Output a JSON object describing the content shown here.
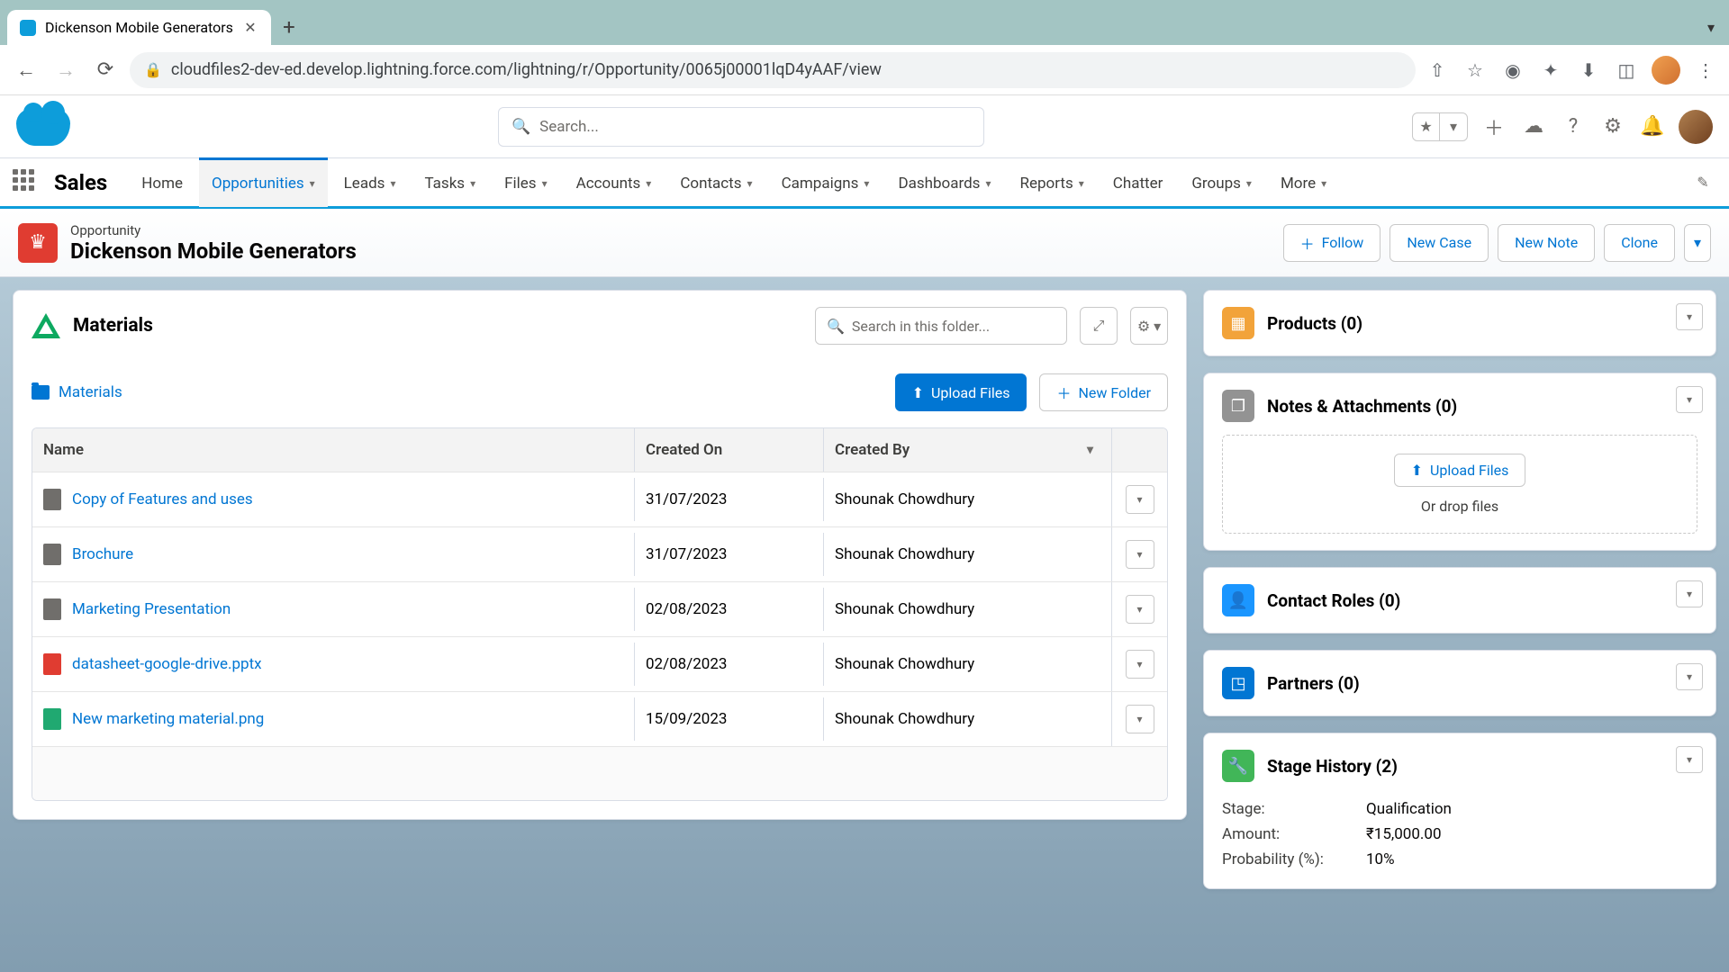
{
  "browser": {
    "tab_title": "Dickenson Mobile Generators",
    "url": "cloudfiles2-dev-ed.develop.lightning.force.com/lightning/r/Opportunity/0065j00001lqD4yAAF/view"
  },
  "sf": {
    "search_placeholder": "Search...",
    "app_name": "Sales",
    "nav": [
      "Home",
      "Opportunities",
      "Leads",
      "Tasks",
      "Files",
      "Accounts",
      "Contacts",
      "Campaigns",
      "Dashboards",
      "Reports",
      "Chatter",
      "Groups",
      "More"
    ]
  },
  "record": {
    "type": "Opportunity",
    "title": "Dickenson Mobile Generators",
    "actions": {
      "follow": "Follow",
      "new_case": "New Case",
      "new_note": "New Note",
      "clone": "Clone"
    }
  },
  "materials": {
    "title": "Materials",
    "search_placeholder": "Search in this folder...",
    "breadcrumb": "Materials",
    "upload_btn": "Upload Files",
    "new_folder_btn": "New Folder",
    "cols": {
      "name": "Name",
      "created_on": "Created On",
      "created_by": "Created By"
    },
    "rows": [
      {
        "name": "Copy of Features and uses",
        "date": "31/07/2023",
        "by": "Shounak Chowdhury",
        "icon": "generic"
      },
      {
        "name": "Brochure",
        "date": "31/07/2023",
        "by": "Shounak Chowdhury",
        "icon": "generic"
      },
      {
        "name": "Marketing Presentation",
        "date": "02/08/2023",
        "by": "Shounak Chowdhury",
        "icon": "generic"
      },
      {
        "name": "datasheet-google-drive.pptx",
        "date": "02/08/2023",
        "by": "Shounak Chowdhury",
        "icon": "red"
      },
      {
        "name": "New marketing material.png",
        "date": "15/09/2023",
        "by": "Shounak Chowdhury",
        "icon": "green"
      }
    ]
  },
  "side": {
    "products": "Products (0)",
    "notes": "Notes & Attachments (0)",
    "notes_upload": "Upload Files",
    "notes_drop": "Or drop files",
    "contact_roles": "Contact Roles (0)",
    "partners": "Partners (0)",
    "stage_history": "Stage History (2)",
    "stage": {
      "stage_l": "Stage:",
      "stage_v": "Qualification",
      "amount_l": "Amount:",
      "amount_v": "₹15,000.00",
      "prob_l": "Probability (%):",
      "prob_v": "10%"
    }
  }
}
